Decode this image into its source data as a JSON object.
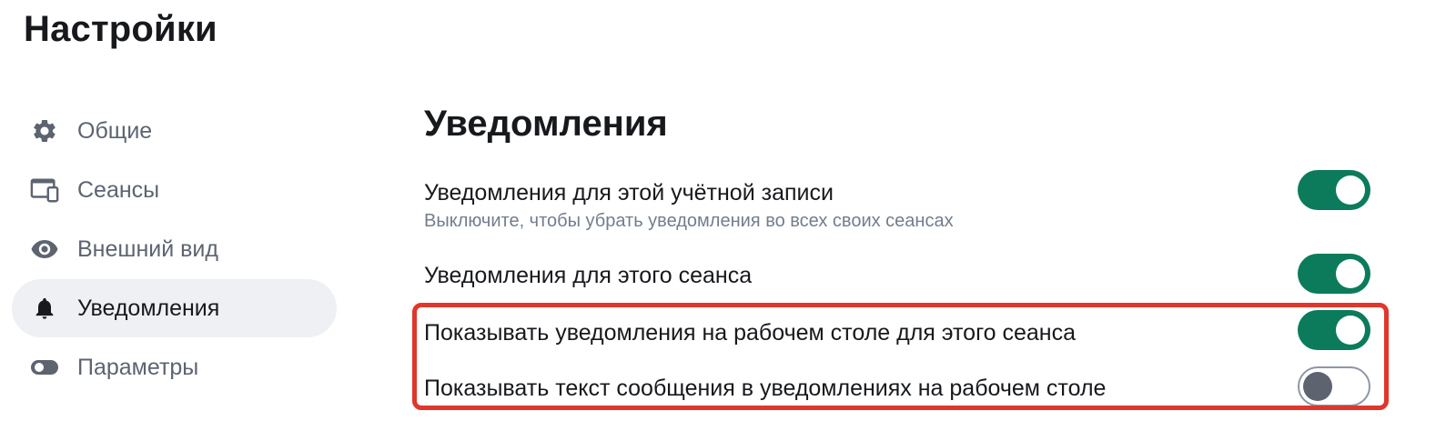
{
  "page": {
    "title": "Настройки"
  },
  "sidebar": {
    "items": [
      {
        "icon": "gear-icon",
        "label": "Общие",
        "active": false
      },
      {
        "icon": "devices-icon",
        "label": "Сеансы",
        "active": false
      },
      {
        "icon": "eye-icon",
        "label": "Внешний вид",
        "active": false
      },
      {
        "icon": "bell-icon",
        "label": "Уведомления",
        "active": true
      },
      {
        "icon": "toggle-icon",
        "label": "Параметры",
        "active": false
      }
    ]
  },
  "main": {
    "section_title": "Уведомления",
    "settings": [
      {
        "label": "Уведомления для этой учётной записи",
        "description": "Выключите, чтобы убрать уведомления во всех своих сеансах",
        "enabled": true
      },
      {
        "label": "Уведомления для этого сеанса",
        "enabled": true
      },
      {
        "label": "Показывать уведомления на рабочем столе для этого сеанса",
        "enabled": true
      },
      {
        "label": "Показывать текст сообщения в уведомлениях на рабочем столе",
        "enabled": false
      }
    ]
  },
  "colors": {
    "accent": "#0b7b5b",
    "highlight": "#e0362b",
    "muted_text": "#737d8c",
    "active_bg": "#eef0f3"
  }
}
